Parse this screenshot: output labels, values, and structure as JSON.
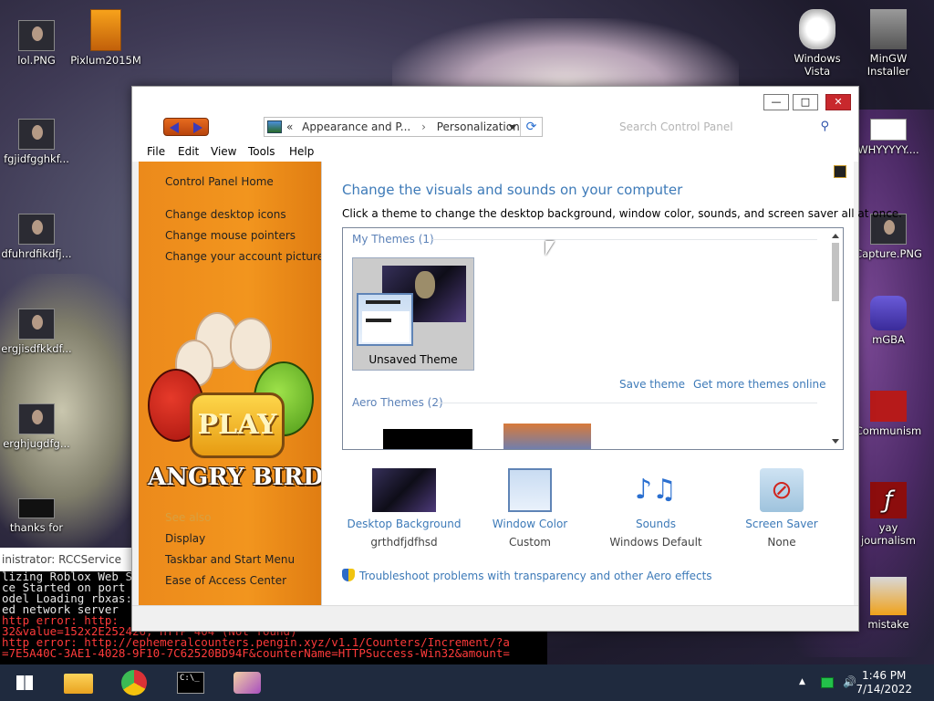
{
  "desktop": {
    "icons_left": [
      {
        "label": "lol.PNG"
      },
      {
        "label": "Pixlum2015M"
      },
      {
        "label": "fgjidfgghkf..."
      },
      {
        "label": "dfuhrdfikdfj..."
      },
      {
        "label": "ergjisdfkkdf..."
      },
      {
        "label": "erghjugdfg..."
      },
      {
        "label": "thanks for"
      }
    ],
    "icons_right": [
      {
        "label": "Windows Vista"
      },
      {
        "label": "MinGW Installer"
      },
      {
        "label": "WHYYYYY...."
      },
      {
        "label": "Capture.PNG"
      },
      {
        "label": "mGBA"
      },
      {
        "label": "Communism"
      },
      {
        "label": "yay journalism"
      },
      {
        "label": "mistake"
      }
    ]
  },
  "console": {
    "title": "inistrator:  RCCService",
    "lines": [
      {
        "text": "lizing Roblox Web S",
        "error": false
      },
      {
        "text": "ce Started on port",
        "error": false
      },
      {
        "text": "odel Loading rbxas:",
        "error": false
      },
      {
        "text": "ed network server",
        "error": false
      },
      {
        "text": " http error: http:",
        "error": true
      },
      {
        "text": "32&value=152x2E252426, HTTP 404 (Not found)",
        "error": true
      },
      {
        "text": " http error: http://ephemeralcounters.pengin.xyz/v1.1/Counters/Increment/?a",
        "error": true
      },
      {
        "text": "=7E5A40C-3AE1-4028-9F10-7C62520BD94F&counterName=HTTPSuccess-Win32&amount=",
        "error": true
      }
    ]
  },
  "window": {
    "address": {
      "prefix": "«",
      "crumb1": "Appearance and P...",
      "sep": "›",
      "crumb2": "Personalization"
    },
    "search_placeholder": "Search Control Panel",
    "menu": [
      "File",
      "Edit",
      "View",
      "Tools",
      "Help"
    ],
    "controls": {
      "minimize": "—",
      "maximize": "□",
      "close": "✕"
    }
  },
  "left_pane": {
    "home": "Control Panel Home",
    "links": [
      "Change desktop icons",
      "Change mouse pointers",
      "Change your account picture"
    ],
    "see_also": "See also",
    "see_also_links": [
      "Display",
      "Taskbar and Start Menu",
      "Ease of Access Center"
    ],
    "ad_play": "PLAY",
    "ad_title": "ANGRY BIRDS"
  },
  "main": {
    "heading": "Change the visuals and sounds on your computer",
    "description": "Click a theme to change the desktop background, window color, sounds, and screen saver all at once.",
    "my_themes": "My Themes (1)",
    "unsaved_theme": "Unsaved Theme",
    "save_theme": "Save theme",
    "get_more": "Get more themes online",
    "aero_themes": "Aero Themes (2)",
    "settings": [
      {
        "title": "Desktop Background",
        "value": "grthdfjdfhsd"
      },
      {
        "title": "Window Color",
        "value": "Custom"
      },
      {
        "title": "Sounds",
        "value": "Windows Default"
      },
      {
        "title": "Screen Saver",
        "value": "None"
      }
    ],
    "troubleshoot": "Troubleshoot problems with transparency and other Aero effects"
  },
  "taskbar": {
    "time": "1:46 PM",
    "date": "7/14/2022",
    "tray_arrow": "▲",
    "volume": "🔊"
  },
  "colors": {
    "accent_link": "#3d7ab8",
    "left_pane": "#f2951e",
    "taskbar": "#1f2a3e",
    "close_btn": "#c8282d"
  }
}
